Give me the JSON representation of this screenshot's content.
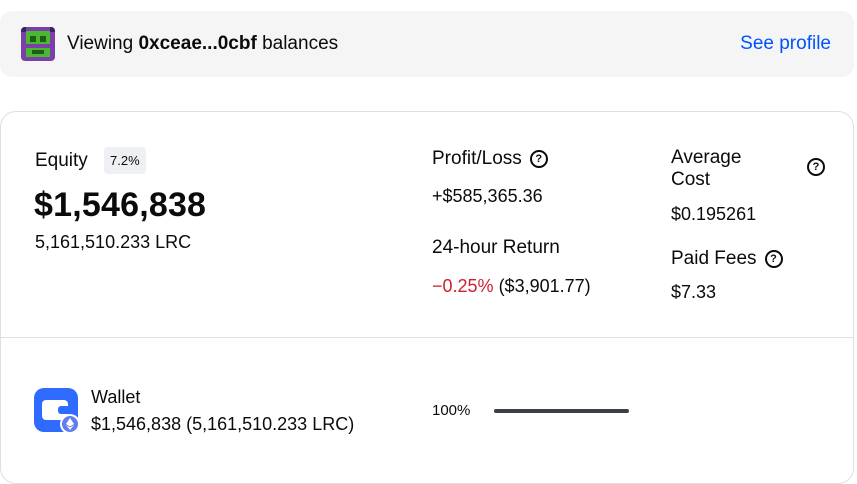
{
  "banner": {
    "prefix": "Viewing ",
    "address": "0xceae...0cbf",
    "suffix": " balances",
    "see_profile": "See profile"
  },
  "equity": {
    "label": "Equity",
    "badge": "7.2%",
    "value": "$1,546,838",
    "amount": "5,161,510.233 LRC"
  },
  "profit_loss": {
    "label": "Profit/Loss",
    "value": "+$585,365.36"
  },
  "return_24h": {
    "label": "24-hour Return",
    "pct": "−0.25%",
    "value": " ($3,901.77)"
  },
  "average_cost": {
    "label": "Average Cost",
    "value": "$0.195261"
  },
  "paid_fees": {
    "label": "Paid Fees",
    "value": "$7.33"
  },
  "wallet": {
    "title": "Wallet",
    "subtitle": "$1,546,838 (5,161,510.233 LRC)",
    "percent_label": "100%",
    "allocation_fraction": 1.0
  },
  "colors": {
    "link": "#0052ff",
    "negative": "#cf202f",
    "wallet_icon": "#2f6bff"
  },
  "icons": {
    "help": "?",
    "wallet": "wallet-icon",
    "ethereum_badge": "ethereum-icon"
  }
}
